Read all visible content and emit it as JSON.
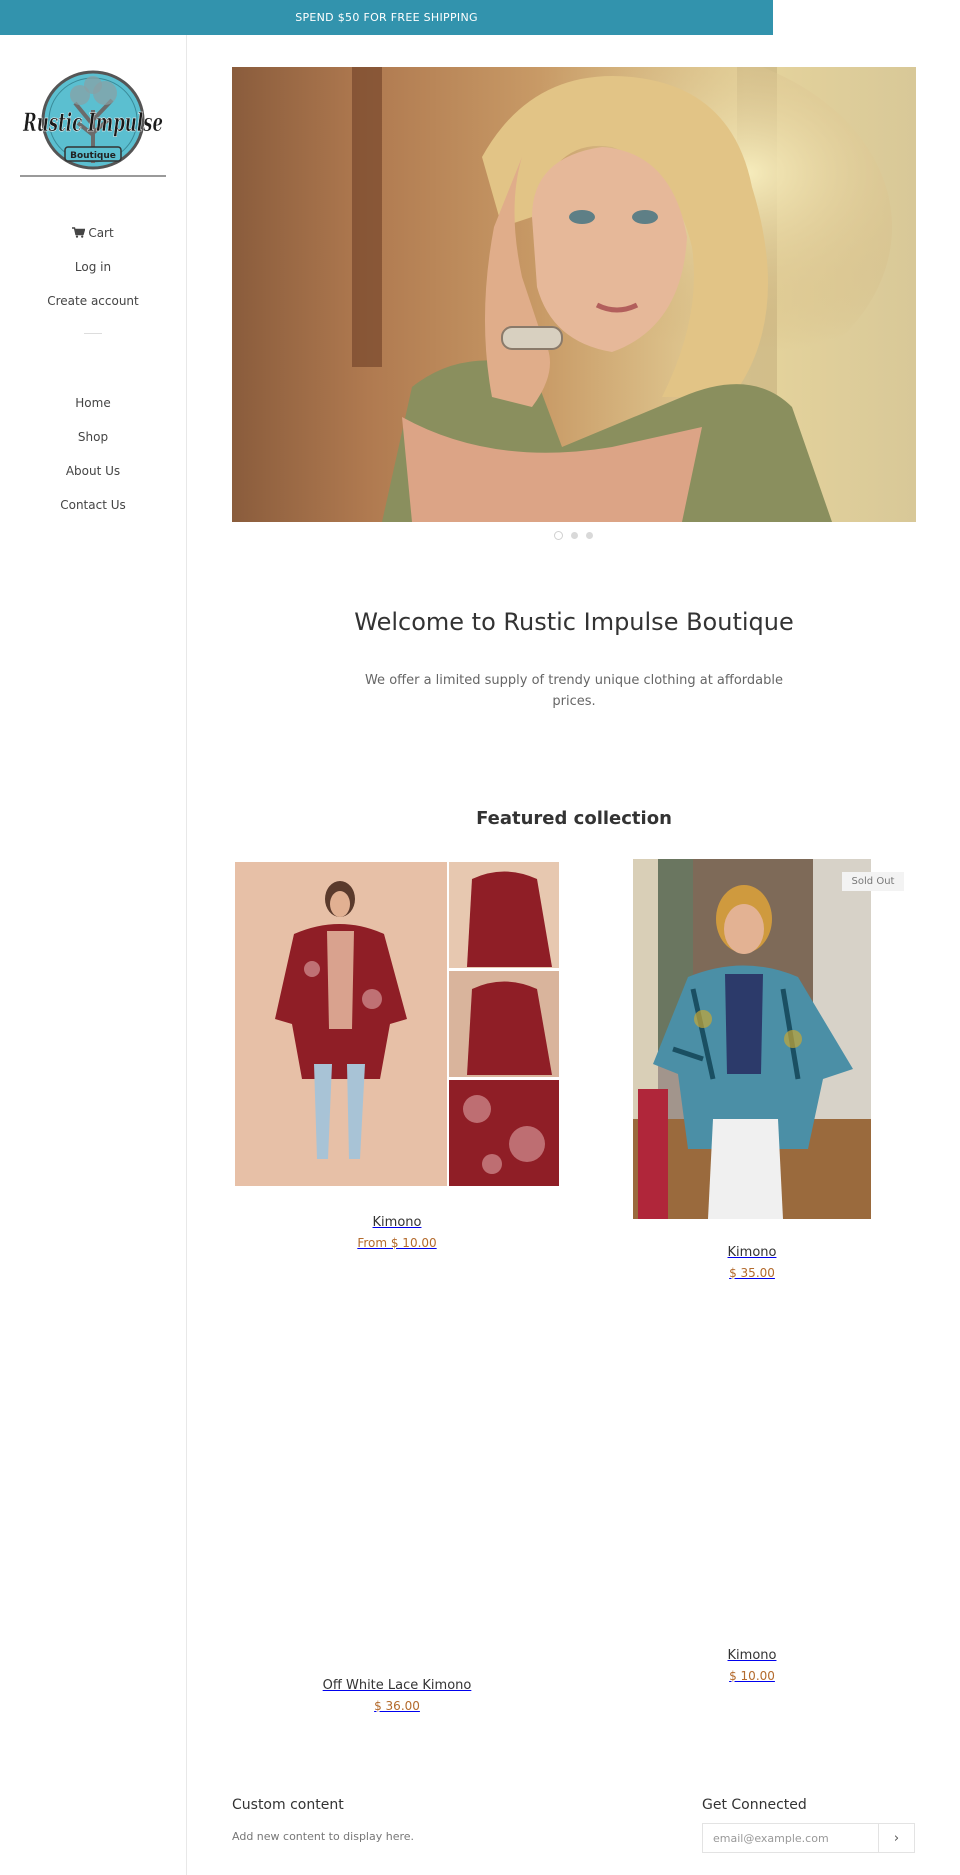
{
  "announcement": "SPEND $50 FOR FREE SHIPPING",
  "brand": {
    "logo_text": "Rustic Impulse",
    "logo_subtext": "Boutique"
  },
  "account_nav": [
    {
      "label": "Cart",
      "icon": "cart-icon"
    },
    {
      "label": "Log in"
    },
    {
      "label": "Create account"
    }
  ],
  "main_nav": [
    {
      "label": "Home"
    },
    {
      "label": "Shop"
    },
    {
      "label": "About Us"
    },
    {
      "label": "Contact Us"
    }
  ],
  "slideshow": {
    "slide_count": 3,
    "active_index": 0
  },
  "welcome": {
    "title": "Welcome to Rustic Impulse Boutique",
    "text": "We offer a limited supply of trendy unique clothing at affordable prices."
  },
  "featured": {
    "title": "Featured collection",
    "products": [
      {
        "name": "Kimono",
        "price": "From $ 10.00"
      },
      {
        "name": "Kimono",
        "price": "$ 35.00",
        "badge": "Sold Out"
      },
      {
        "name": "Off White Lace Kimono",
        "price": "$ 36.00"
      },
      {
        "name": "Kimono",
        "price": "$ 10.00"
      }
    ]
  },
  "footer": {
    "custom_title": "Custom content",
    "custom_text": "Add new content to display here.",
    "connect_title": "Get Connected",
    "email_placeholder": "email@example.com",
    "submit_label": "›"
  },
  "colors": {
    "announcement_bg": "#3293ad",
    "price": "#b36a2c",
    "logo_teal": "#5bbfd0"
  }
}
